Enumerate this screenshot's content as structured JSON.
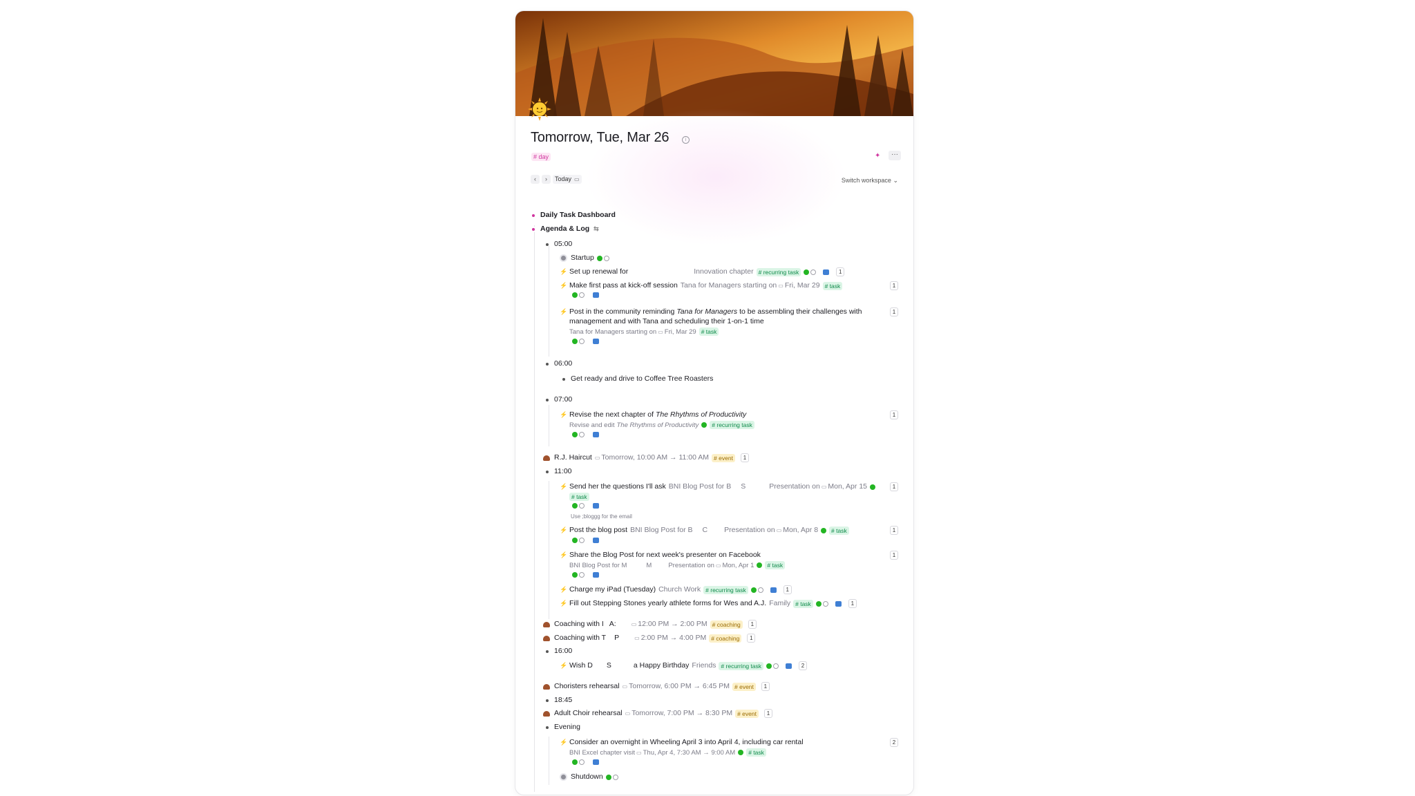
{
  "header": {
    "title": "Tomorrow, Tue, Mar 26",
    "day_tag": "# day",
    "today_label": "Today",
    "switch_label": "Switch workspace",
    "more_label": "···"
  },
  "sections": {
    "dashboard": "Daily Task Dashboard",
    "agenda": "Agenda & Log"
  },
  "times": {
    "t0500": "05:00",
    "t0600": "06:00",
    "t0700": "07:00",
    "t1100": "11:00",
    "t1600": "16:00",
    "t1845": "18:45",
    "evening": "Evening"
  },
  "items": {
    "startup": "Startup",
    "renewal": {
      "label": "Set up renewal for",
      "ref": "Innovation chapter",
      "tag": "# recurring task",
      "count": "1"
    },
    "kickoff": {
      "label": "Make first pass at kick-off session",
      "ref": "Tana for Managers starting on",
      "date": "Fri, Mar 29",
      "tag": "# task",
      "count": "1"
    },
    "post_community": {
      "label_a": "Post in the community reminding ",
      "label_it": "Tana for Managers",
      "label_b": " to be assembling their challenges with",
      "label_c": "management and with Tana and scheduling their 1-on-1 time",
      "ref": "Tana for Managers starting on",
      "date": "Fri, Mar 29",
      "tag": "# task",
      "count": "1"
    },
    "coffee": "Get ready and drive to Coffee Tree Roasters",
    "revise": {
      "label_a": "Revise the next chapter of ",
      "label_it": "The Rhythms of Productivity",
      "ref_a": "Revise and edit ",
      "ref_it": "The Rhythms of Productivity",
      "tag": "# recurring task",
      "count": "1"
    },
    "haircut": {
      "label": "R.J. Haircut",
      "date": "Tomorrow, 10:00 AM → 11:00 AM",
      "tag": "# event",
      "count": "1"
    },
    "questions": {
      "label": "Send her the questions I'll ask",
      "ref_a": "BNI Blog Post for B",
      "ref_b": "S",
      "ref_c": "Presentation on",
      "date": "Mon, Apr 15",
      "tag": "# task",
      "note": "Use ;bloggg for the email",
      "count": "1"
    },
    "blog_post": {
      "label": "Post the blog post",
      "ref_a": "BNI Blog Post for B",
      "ref_b": "C",
      "ref_c": "Presentation on",
      "date": "Mon, Apr 8",
      "tag": "# task",
      "count": "1"
    },
    "share": {
      "label": "Share the Blog Post for next week's presenter on Facebook",
      "ref_a": "BNI Blog Post for M",
      "ref_b": "M",
      "ref_c": "Presentation on",
      "date": "Mon, Apr 1",
      "tag": "# task",
      "count": "1"
    },
    "ipad": {
      "label": "Charge my iPad (Tuesday)",
      "ref": "Church Work",
      "tag": "# recurring task",
      "count": "1"
    },
    "stepping": {
      "label": "Fill out Stepping Stones yearly athlete forms for Wes and A.J.",
      "ref": "Family",
      "tag": "# task",
      "count": "1"
    },
    "coaching1": {
      "label_a": "Coaching with I",
      "label_b": "A:",
      "date": "12:00 PM → 2:00 PM",
      "tag": "# coaching",
      "count": "1"
    },
    "coaching2": {
      "label_a": "Coaching with T",
      "label_b": "P",
      "date": "2:00 PM → 4:00 PM",
      "tag": "# coaching",
      "count": "1"
    },
    "birthday": {
      "label_a": "Wish D",
      "label_b": "S",
      "label_c": "a Happy Birthday",
      "ref": "Friends",
      "tag": "# recurring task",
      "count": "2"
    },
    "choristers": {
      "label": "Choristers rehearsal",
      "date": "Tomorrow, 6:00 PM → 6:45 PM",
      "tag": "# event",
      "count": "1"
    },
    "adult_choir": {
      "label": "Adult Choir rehearsal",
      "date": "Tomorrow, 7:00 PM → 8:30 PM",
      "tag": "# event",
      "count": "1"
    },
    "wheeling": {
      "label": "Consider an overnight in Wheeling April 3 into April 4, including car rental",
      "ref": "BNI Excel chapter visit",
      "date": "Thu, Apr 4, 7:30 AM → 9:00 AM",
      "tag": "# task",
      "count": "2"
    },
    "shutdown": "Shutdown"
  },
  "colors": {
    "accent": "#d0369f",
    "task_tag": "#0e8a4a",
    "event_tag": "#9a6a00"
  }
}
